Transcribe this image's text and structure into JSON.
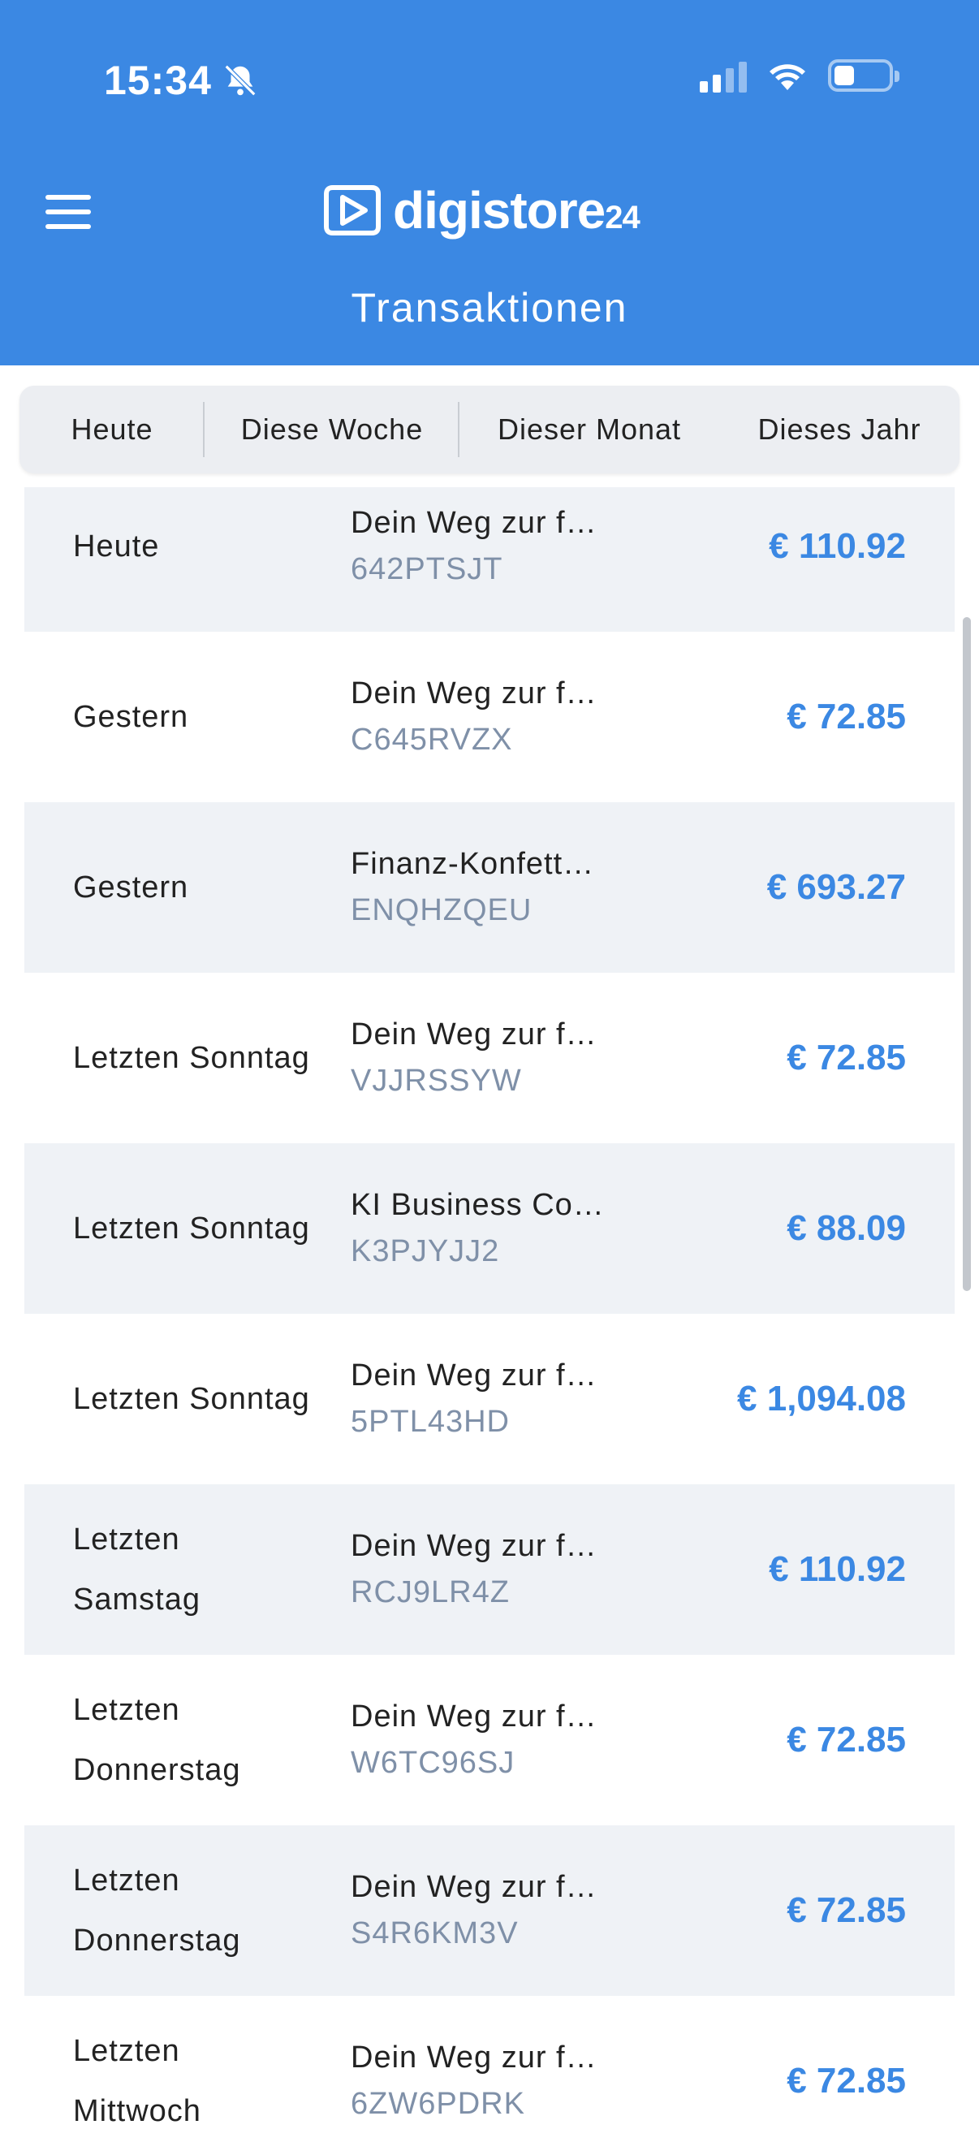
{
  "status_bar": {
    "time": "15:34"
  },
  "header": {
    "logo_text": "digistore",
    "logo_suffix": "24",
    "title": "Transaktionen"
  },
  "tabs": [
    "Heute",
    "Diese Woche",
    "Dieser Monat",
    "Dieses Jahr"
  ],
  "transactions": [
    {
      "date": "Heute",
      "product": "Dein Weg zur f…",
      "id": "642PTSJT",
      "amount": "€ 110.92"
    },
    {
      "date": "Gestern",
      "product": "Dein Weg zur f…",
      "id": "C645RVZX",
      "amount": "€ 72.85"
    },
    {
      "date": "Gestern",
      "product": "Finanz-Konfett…",
      "id": "ENQHZQEU",
      "amount": "€ 693.27"
    },
    {
      "date": "Letzten Sonntag",
      "product": "Dein Weg zur f…",
      "id": "VJJRSSYW",
      "amount": "€ 72.85"
    },
    {
      "date": "Letzten Sonntag",
      "product": "KI Business Co…",
      "id": "K3PJYJJ2",
      "amount": "€ 88.09"
    },
    {
      "date": "Letzten Sonntag",
      "product": "Dein Weg zur f…",
      "id": "5PTL43HD",
      "amount": "€ 1,094.08"
    },
    {
      "date": "Letzten Samstag",
      "product": "Dein Weg zur f…",
      "id": "RCJ9LR4Z",
      "amount": "€ 110.92"
    },
    {
      "date": "Letzten Donnerstag",
      "product": "Dein Weg zur f…",
      "id": "W6TC96SJ",
      "amount": "€ 72.85"
    },
    {
      "date": "Letzten Donnerstag",
      "product": "Dein Weg zur f…",
      "id": "S4R6KM3V",
      "amount": "€ 72.85"
    },
    {
      "date": "Letzten Mittwoch",
      "product": "Dein Weg zur f…",
      "id": "6ZW6PDRK",
      "amount": "€ 72.85"
    }
  ],
  "colors": {
    "primary": "#3b88e3",
    "row_alt": "#eff2f6",
    "muted_text": "#7f90a8"
  }
}
